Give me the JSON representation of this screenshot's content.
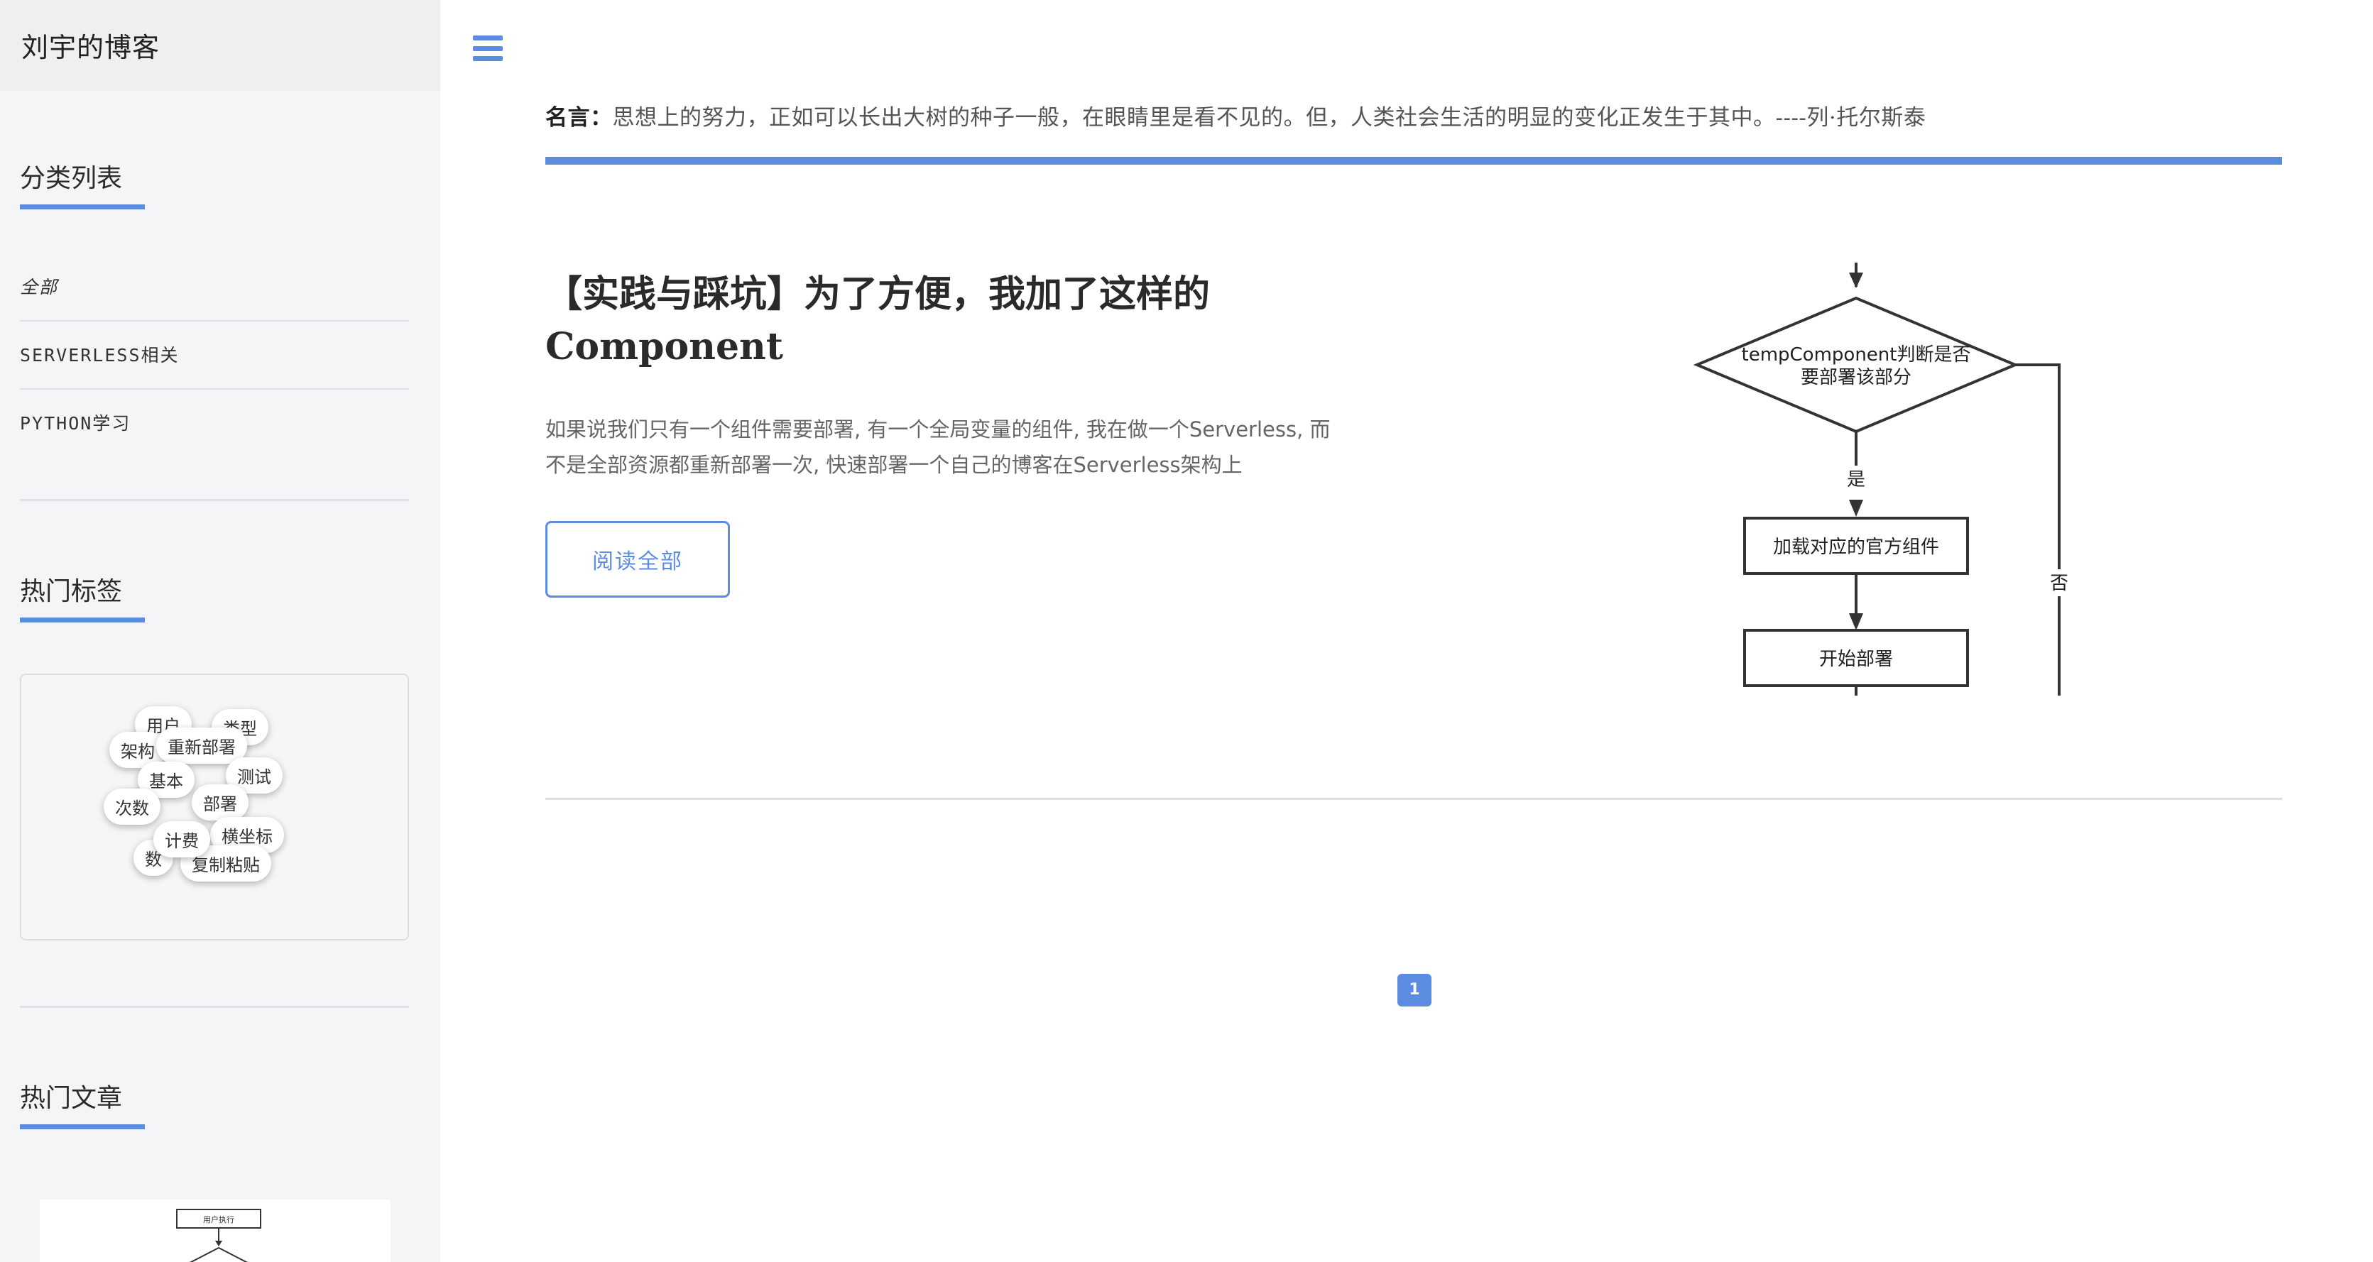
{
  "sidebar": {
    "brand": "刘宇的博客",
    "categories_heading": "分类列表",
    "categories": [
      "全部",
      "SERVERLESS相关",
      "PYTHON学习"
    ],
    "tags_heading": "热门标签",
    "tags": [
      "用户",
      "类型",
      "架构",
      "重新部署",
      "基本",
      "测试",
      "次数",
      "部署",
      "计费",
      "横坐标",
      "复制粘贴",
      "数"
    ],
    "articles_heading": "热门文章",
    "article_thumb_text": "用户执行"
  },
  "main": {
    "quote_label": "名言：",
    "quote_text": "思想上的努力，正如可以长出大树的种子一般，在眼睛里是看不见的。但，人类社会生活的明显的变化正发生于其中。----列·托尔斯泰",
    "post": {
      "title": "【实践与踩坑】为了方便，我加了这样的Component",
      "excerpt": "如果说我们只有一个组件需要部署, 有一个全局变量的组件, 我在做一个Serverless, 而不是全部资源都重新部署一次, 快速部署一个自己的博客在Serverless架构上",
      "read_more": "阅读全部",
      "flowchart": {
        "decision_line1": "tempComponent判断是否",
        "decision_line2": "要部署该部分",
        "yes": "是",
        "no": "否",
        "step1": "加载对应的官方组件",
        "step2": "开始部署"
      }
    },
    "pagination": {
      "current": "1"
    }
  },
  "colors": {
    "accent": "#5c8ce0",
    "sidebar_bg": "#f4f5f6"
  }
}
